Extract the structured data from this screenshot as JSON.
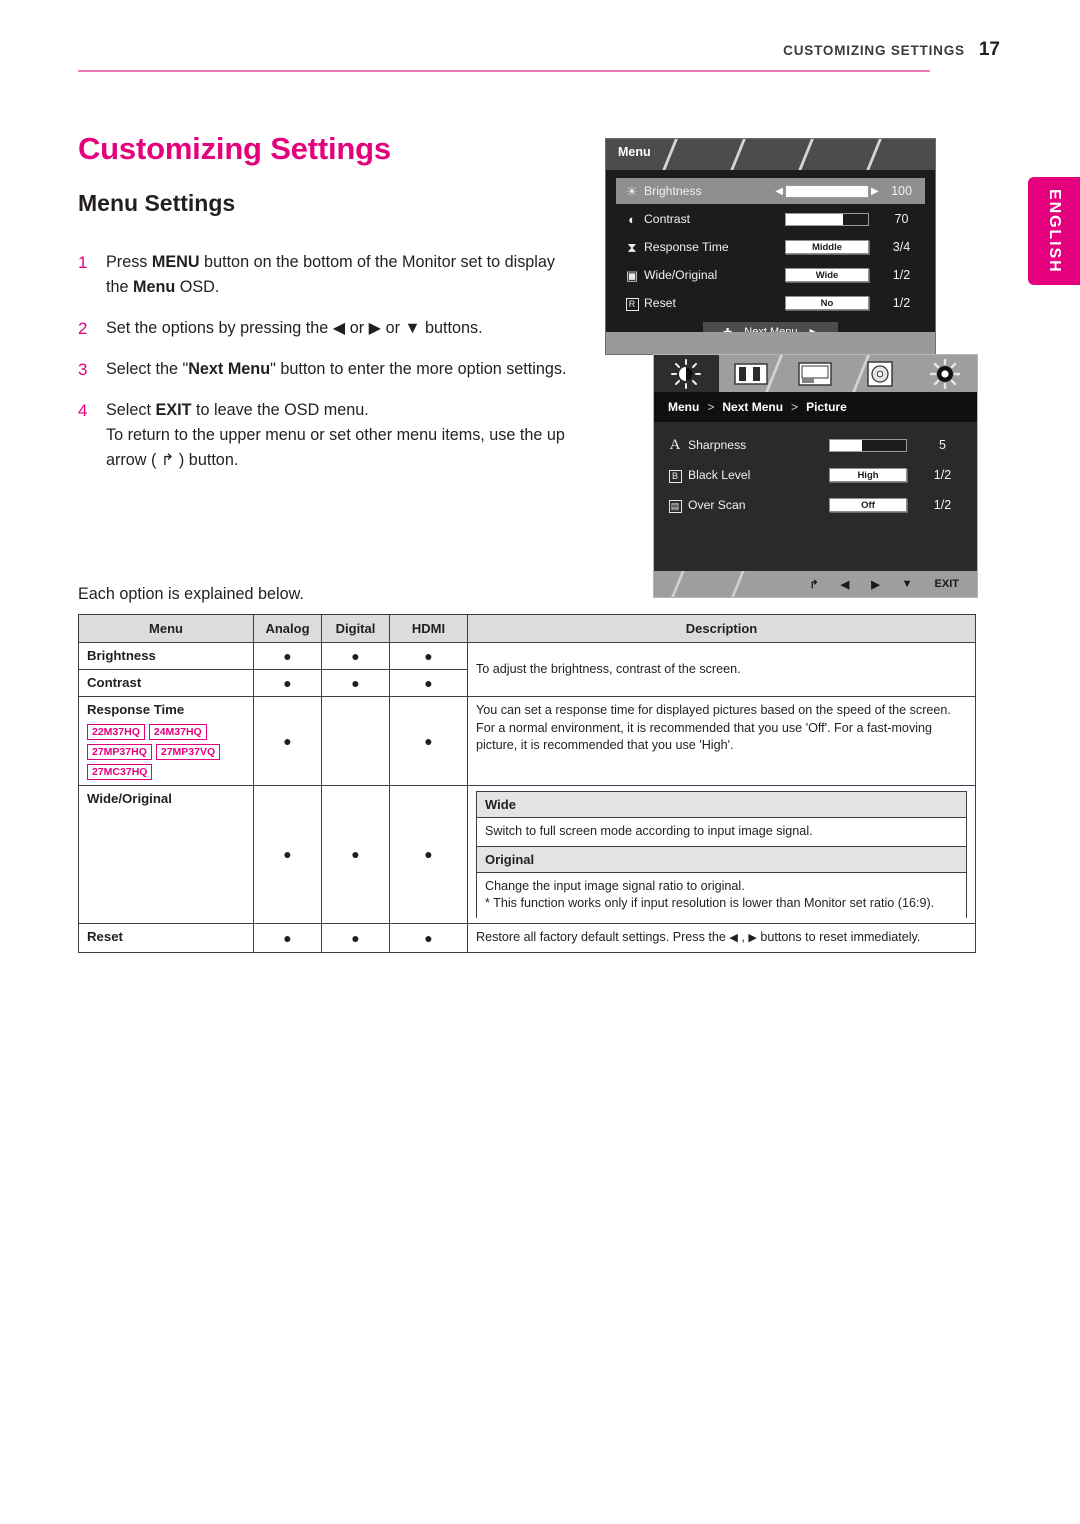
{
  "header": {
    "running_title": "CUSTOMIZING SETTINGS",
    "page_number": "17"
  },
  "language_tab": {
    "label": "ENGLISH"
  },
  "headings": {
    "h1": "Customizing Settings",
    "h2": "Menu Settings"
  },
  "steps": [
    {
      "num": "1",
      "parts": [
        {
          "t": "Press ",
          "b": false
        },
        {
          "t": "MENU",
          "b": true
        },
        {
          "t": " button on the bottom of the Monitor set to display the ",
          "b": false
        },
        {
          "t": "Menu",
          "b": true
        },
        {
          "t": " OSD.",
          "b": false
        }
      ]
    },
    {
      "num": "2",
      "parts": [
        {
          "t": "Set the options by pressing the ",
          "b": false
        },
        {
          "t": "◀",
          "b": false
        },
        {
          "t": " or ",
          "b": false
        },
        {
          "t": "▶",
          "b": false
        },
        {
          "t": " or ",
          "b": false
        },
        {
          "t": "▼",
          "b": false
        },
        {
          "t": " buttons.",
          "b": false
        }
      ]
    },
    {
      "num": "3",
      "parts": [
        {
          "t": "Select the \"",
          "b": false
        },
        {
          "t": "Next Menu",
          "b": true
        },
        {
          "t": "\" button to enter the more option settings.",
          "b": false
        }
      ]
    },
    {
      "num": "4",
      "parts": [
        {
          "t": "Select ",
          "b": false
        },
        {
          "t": "EXIT",
          "b": true
        },
        {
          "t": " to leave the OSD menu.",
          "b": false
        },
        {
          "t": "\nTo return to the upper menu or set other menu items, use the up arrow ( ↱ ) button.",
          "b": false
        }
      ]
    }
  ],
  "each_option_note": "Each option is explained below.",
  "osd_menu": {
    "tab_label": "Menu",
    "rows": [
      {
        "icon": "brightness-icon",
        "glyph": "☀",
        "label": "Brightness",
        "control": "slider",
        "fill_pct": 100,
        "value": "100",
        "selected": true
      },
      {
        "icon": "contrast-icon",
        "glyph": "◐",
        "label": "Contrast",
        "control": "slider",
        "fill_pct": 70,
        "value": "70",
        "selected": false
      },
      {
        "icon": "response-time-icon",
        "glyph": "⧗",
        "label": "Response Time",
        "control": "textbox",
        "text": "Middle",
        "value": "3/4",
        "selected": false
      },
      {
        "icon": "wide-original-icon",
        "glyph": "▣",
        "label": "Wide/Original",
        "control": "textbox",
        "text": "Wide",
        "value": "1/2",
        "selected": false
      },
      {
        "icon": "reset-icon",
        "glyph": "R",
        "label": "Reset",
        "control": "textbox",
        "text": "No",
        "value": "1/2",
        "selected": false
      }
    ],
    "next_menu_label": "Next Menu"
  },
  "osd_picture": {
    "tabs": [
      {
        "name": "picture-tab",
        "active": true
      },
      {
        "name": "color-tab",
        "active": false
      },
      {
        "name": "display-tab",
        "active": false
      },
      {
        "name": "others-tab",
        "active": false
      },
      {
        "name": "settings-tab",
        "active": false
      }
    ],
    "breadcrumb": [
      "Menu",
      "Next Menu",
      "Picture"
    ],
    "breadcrumb_sep": ">",
    "rows": [
      {
        "icon": "sharpness-icon",
        "glyph": "A",
        "label": "Sharpness",
        "control": "slider",
        "fill_pct": 42,
        "value": "5"
      },
      {
        "icon": "black-level-icon",
        "glyph": "B",
        "label": "Black Level",
        "control": "textbox",
        "text": "High",
        "value": "1/2"
      },
      {
        "icon": "over-scan-icon",
        "glyph": "▤",
        "label": "Over Scan",
        "control": "textbox",
        "text": "Off",
        "value": "1/2"
      }
    ],
    "footer_buttons": [
      "↱",
      "◀",
      "▶",
      "▼",
      "EXIT"
    ]
  },
  "table": {
    "headers": [
      "Menu",
      "Analog",
      "Digital",
      "HDMI",
      "Description"
    ],
    "dot": "●",
    "rows": {
      "brightness": {
        "name": "Brightness",
        "analog": true,
        "digital": true,
        "hdmi": true
      },
      "contrast": {
        "name": "Contrast",
        "analog": true,
        "digital": true,
        "hdmi": true
      },
      "brightness_contrast_desc": "To adjust the brightness, contrast of the screen.",
      "response_time": {
        "name": "Response Time",
        "badges": [
          "22M37HQ",
          "24M37HQ",
          "27MP37HQ",
          "27MP37VQ",
          "27MC37HQ"
        ],
        "analog": true,
        "digital": false,
        "hdmi": true,
        "desc": "You can set a response time for displayed pictures based on the speed of the screen. For a normal environment, it is recommended that you use 'Off'. For a fast-moving picture, it is recommended that you use 'High'."
      },
      "wide_original": {
        "name": "Wide/Original",
        "analog": true,
        "digital": true,
        "hdmi": true,
        "sub_wide_title": "Wide",
        "sub_wide_desc": "Switch to full screen mode according to input image signal.",
        "sub_original_title": "Original",
        "sub_original_desc": "Change the input image signal ratio to original.\n* This function works only if input resolution is lower than Monitor set ratio (16:9)."
      },
      "reset": {
        "name": "Reset",
        "analog": true,
        "digital": true,
        "hdmi": true,
        "desc_pre": "Restore all factory default settings. Press the ",
        "desc_mid": " , ",
        "desc_post": " buttons to reset immediately.",
        "left_arrow": "◀",
        "right_arrow": "▶"
      }
    }
  },
  "colors": {
    "brand_magenta": "#e5007e",
    "rule_pink": "#e87bb4",
    "text": "#231f20",
    "table_header_bg": "#dcdcdc",
    "table_subheader_bg": "#e4e4e4"
  }
}
